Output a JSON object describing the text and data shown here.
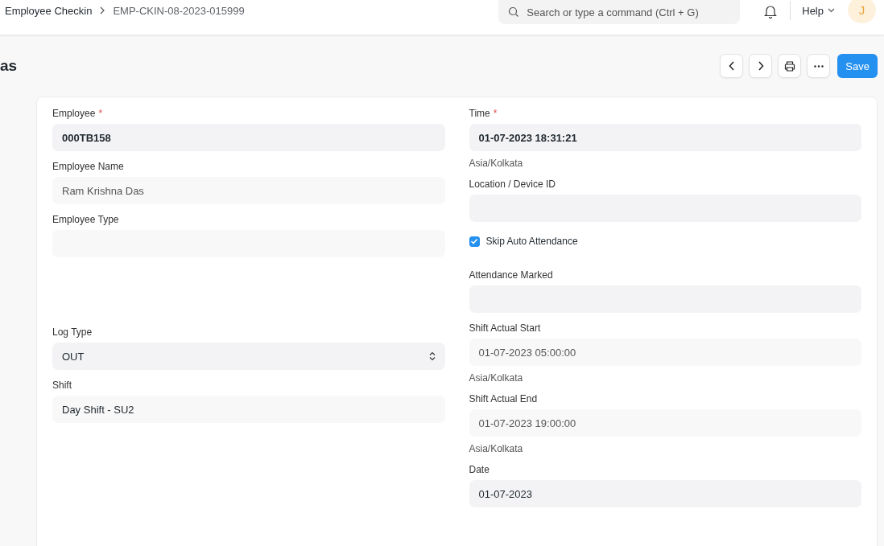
{
  "breadcrumbs": [
    "Employee Checkin",
    "EMP-CKIN-08-2023-015999"
  ],
  "search": {
    "placeholder": "Search or type a command (Ctrl + G)"
  },
  "help": "Help",
  "avatar": "J",
  "page_title": "as",
  "save": "Save",
  "left_fields": [
    {
      "kind": "input",
      "label": "Employee",
      "required_mark": "*",
      "value": "000TB158",
      "bold": true
    },
    {
      "kind": "readonly",
      "label": "Employee Name",
      "value": "Ram Krishna Das"
    },
    {
      "kind": "readonly",
      "label": "Employee Type"
    },
    {
      "kind": "select",
      "label": "Log Type",
      "value": "OUT",
      "break_before": true
    },
    {
      "kind": "link",
      "label": "Shift",
      "value": "Day Shift - SU2"
    }
  ],
  "right_fields": [
    {
      "kind": "input",
      "label": "Time",
      "required_mark": "*",
      "value": "01-07-2023 18:31:21",
      "bold": true,
      "description": "Asia/Kolkata"
    },
    {
      "kind": "input",
      "label": "Location / Device ID"
    },
    {
      "kind": "checkbox",
      "label": "Skip Auto Attendance",
      "checked": true
    },
    {
      "kind": "input",
      "label": "Attendance Marked"
    },
    {
      "kind": "readonly",
      "label": "Shift Actual Start",
      "value": "01-07-2023 05:00:00",
      "description": "Asia/Kolkata"
    },
    {
      "kind": "readonly",
      "label": "Shift Actual End",
      "value": "01-07-2023 19:00:00",
      "description": "Asia/Kolkata"
    },
    {
      "kind": "input",
      "label": "Date",
      "value": "01-07-2023"
    }
  ]
}
